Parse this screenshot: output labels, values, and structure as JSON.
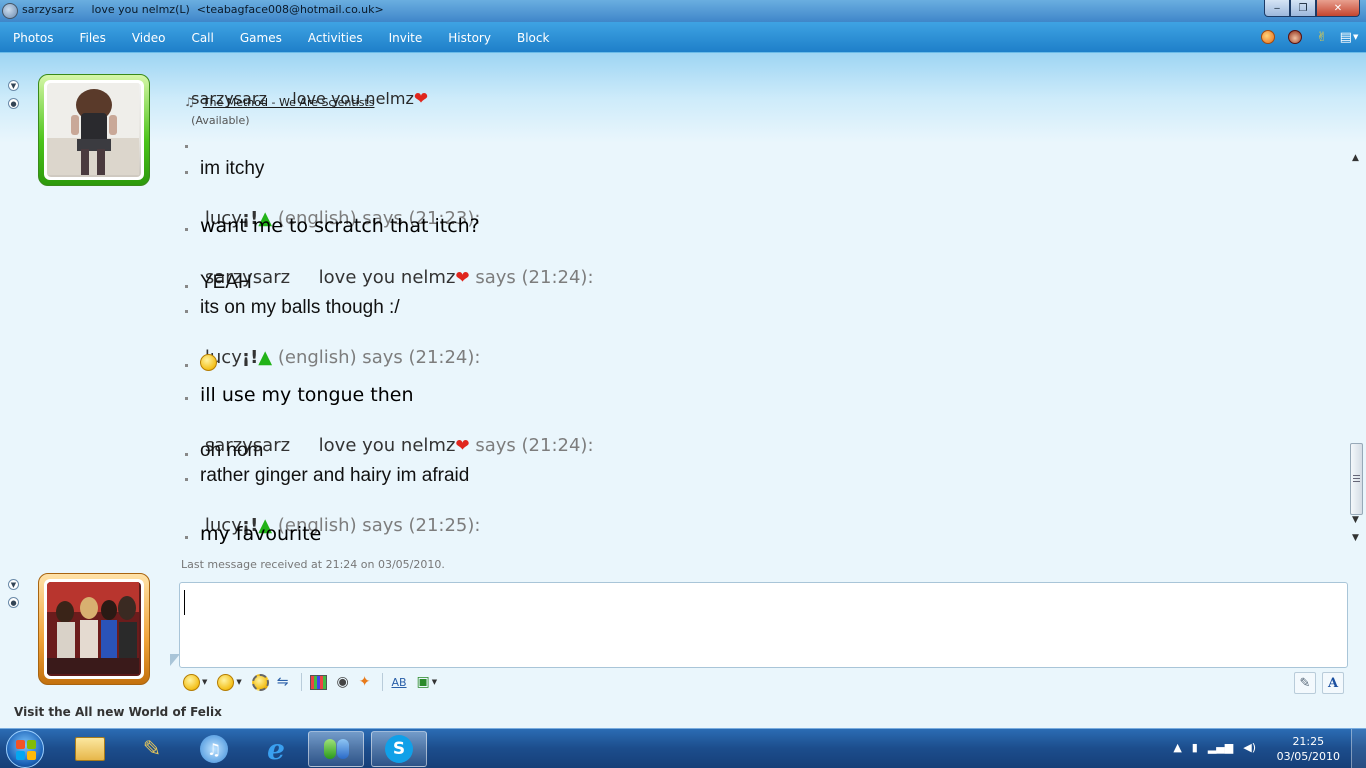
{
  "window": {
    "title": "sarzysarz     love you nelmz(L)  <teabagface008@hotmail.co.uk>",
    "minimize": "‒",
    "maximize": "❐",
    "close": "✕"
  },
  "menu": [
    "Photos",
    "Files",
    "Video",
    "Call",
    "Games",
    "Activities",
    "Invite",
    "History",
    "Block"
  ],
  "contact": {
    "name": "sarzysarz     love you nelmz",
    "status": "(Available)",
    "song": "The Method - We Are Scientists"
  },
  "conversation": {
    "partial_line": "",
    "first_line": "im itchy",
    "messages": [
      {
        "sender": "lucy",
        "sender_suffix": "¡!",
        "sender_tail": " (english) says (21:23):",
        "lines": [
          "want me to scratch that itch?"
        ]
      },
      {
        "sender": "sarzysarz     love you nelmz",
        "sender_suffix": "",
        "sender_tail": " says (21:24):",
        "lines": [
          "YEAH",
          "its on my balls though :/"
        ]
      },
      {
        "sender": "lucy",
        "sender_suffix": "¡!",
        "sender_tail": " (english) says (21:24):",
        "lines": [
          "",
          "ill use my tongue then"
        ]
      },
      {
        "sender": "sarzysarz     love you nelmz",
        "sender_suffix": "",
        "sender_tail": " says (21:24):",
        "lines": [
          "oh nom",
          "rather ginger and hairy im afraid"
        ]
      },
      {
        "sender": "lucy",
        "sender_suffix": "¡!",
        "sender_tail": " (english) says (21:25):",
        "lines": [
          "my favourite"
        ]
      }
    ],
    "last_received": "Last message received at 21:24 on 03/05/2010."
  },
  "input": {
    "value": ""
  },
  "footer": {
    "text": "Visit the All new World of Felix"
  },
  "taskbar": {
    "time": "21:25",
    "date": "03/05/2010"
  },
  "colors": {
    "accent": "#1e7fc9",
    "heart": "#e0261d",
    "triangle": "#22b318"
  }
}
